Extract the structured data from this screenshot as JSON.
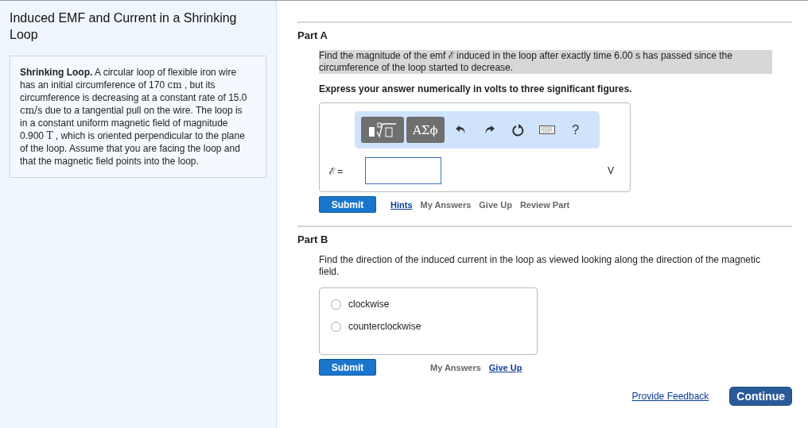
{
  "title": "Induced EMF and Current in a Shrinking Loop",
  "intro": [
    {
      "kind": "bold",
      "text": "Shrinking Loop."
    },
    {
      "kind": "plain",
      "text": " A circular loop of flexible iron wire has an initial circumference of 170 "
    },
    {
      "kind": "math",
      "text": "cm"
    },
    {
      "kind": "plain",
      "text": " , but its circumference is decreasing at a constant rate of 15.0 "
    },
    {
      "kind": "math",
      "text": "cm/s"
    },
    {
      "kind": "plain",
      "text": " due to a tangential pull on the wire. The loop is in a constant uniform magnetic field of magnitude 0.900 "
    },
    {
      "kind": "math",
      "text": "T"
    },
    {
      "kind": "plain",
      "text": " , which is oriented perpendicular to the plane of the loop. Assume that you are facing the loop and that the magnetic field points into the loop."
    }
  ],
  "parts": [
    {
      "kind": "numeric",
      "title": "Part A",
      "question": "Find the magnitude of the emf ℰ induced in the loop after exactly time 6.00 s has passed since the circumference of the loop started to decrease.",
      "highlighted": true,
      "instruction": "Express your answer numerically in volts to three significant figures.",
      "toolbar": {
        "symbols": "ΑΣϕ",
        "help": "?"
      },
      "answer_label": "ℰ =",
      "unit": "V",
      "submit": "Submit",
      "links": [
        {
          "text": "Hints",
          "disabled": false
        },
        {
          "text": "My Answers",
          "disabled": true
        },
        {
          "text": "Give Up",
          "disabled": true
        },
        {
          "text": "Review Part",
          "disabled": true
        }
      ]
    },
    {
      "kind": "choice",
      "title": "Part B",
      "question": "Find the direction of the induced current in the loop as viewed looking along the direction of the magnetic field.",
      "highlighted": false,
      "options": [
        {
          "label": "clockwise",
          "selected": false
        },
        {
          "label": "counterclockwise",
          "selected": false
        }
      ],
      "submit": "Submit",
      "links": [
        {
          "text": "My Answers",
          "disabled": true
        },
        {
          "text": "Give Up",
          "disabled": false
        }
      ]
    }
  ],
  "footer": {
    "feedback": "Provide Feedback",
    "continue": "Continue"
  }
}
